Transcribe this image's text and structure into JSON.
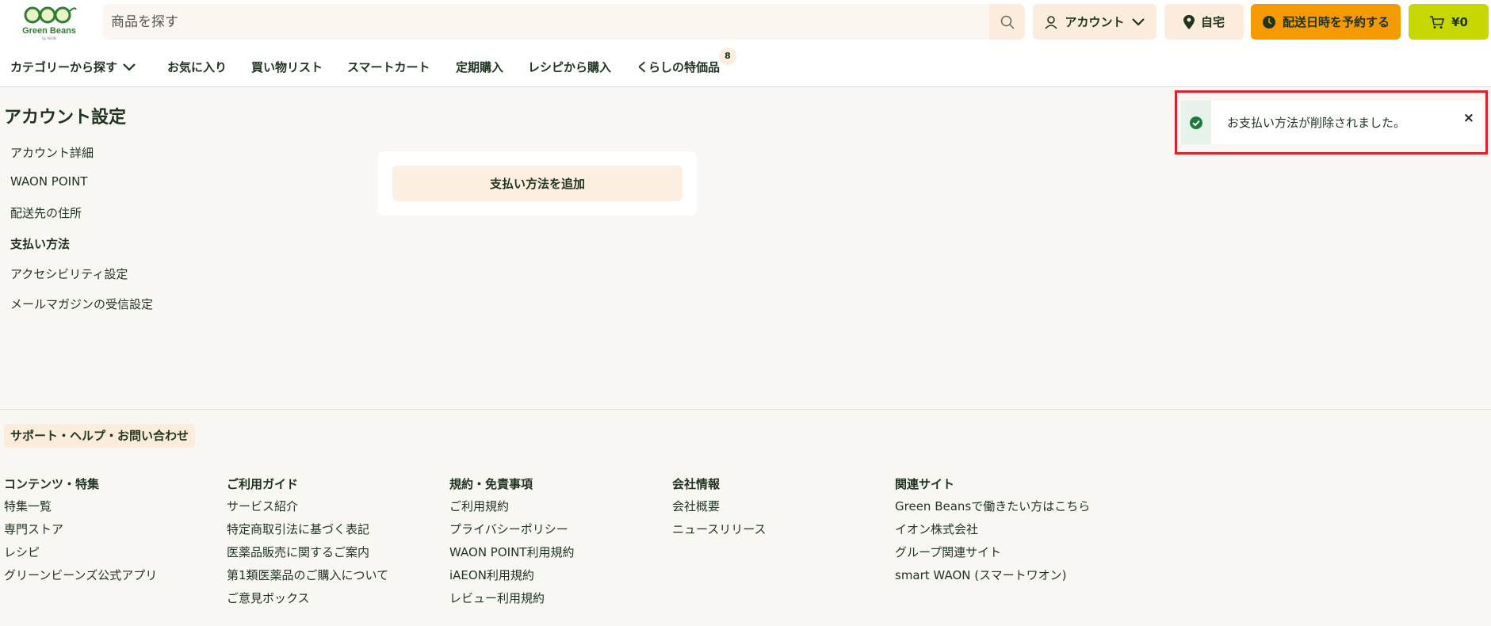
{
  "header": {
    "logo_text": "Green Beans",
    "logo_sub": "by AEON",
    "search_placeholder": "商品を探す",
    "account_label": "アカウント",
    "home_label": "自宅",
    "delivery_label": "配送日時を予約する",
    "cart_label": "¥0"
  },
  "nav": {
    "category": "カテゴリーから探す",
    "favorites": "お気に入り",
    "shopping_list": "買い物リスト",
    "smart_cart": "スマートカート",
    "subscription": "定期購入",
    "recipe": "レシピから購入",
    "special": "くらしの特価品",
    "special_badge": "8"
  },
  "side": {
    "title": "アカウント設定",
    "items": [
      {
        "label": "アカウント詳細"
      },
      {
        "label": "WAON POINT"
      },
      {
        "label": "配送先の住所"
      },
      {
        "label": "支払い方法"
      },
      {
        "label": "アクセシビリティ設定"
      },
      {
        "label": "メールマガジンの受信設定"
      }
    ]
  },
  "main": {
    "add_payment_label": "支払い方法を追加"
  },
  "toast": {
    "message": "お支払い方法が削除されました。",
    "close": "×"
  },
  "footer": {
    "support": "サポート・ヘルプ・お問い合わせ",
    "columns": [
      {
        "title": "コンテンツ・特集",
        "links": [
          "特集一覧",
          "専門ストア",
          "レシピ",
          "グリーンビーンズ公式アプリ"
        ]
      },
      {
        "title": "ご利用ガイド",
        "links": [
          "サービス紹介",
          "特定商取引法に基づく表記",
          "医薬品販売に関するご案内",
          "第1類医薬品のご購入について",
          "ご意見ボックス"
        ]
      },
      {
        "title": "規約・免責事項",
        "links": [
          "ご利用規約",
          "プライバシーポリシー",
          "WAON POINT利用規約",
          "iAEON利用規約",
          "レビュー利用規約"
        ]
      },
      {
        "title": "会社情報",
        "links": [
          "会社概要",
          "ニュースリリース"
        ]
      },
      {
        "title": "関連サイト",
        "links": [
          "Green Beansで働きたい方はこちら",
          "イオン株式会社",
          "グループ関連サイト",
          "smart WAON (スマートワオン)"
        ]
      }
    ]
  },
  "colors": {
    "brand_green": "#2e7d32",
    "delivery_orange": "#f59b00",
    "cart_lime": "#c6d800",
    "highlight_red": "#e0202c"
  }
}
